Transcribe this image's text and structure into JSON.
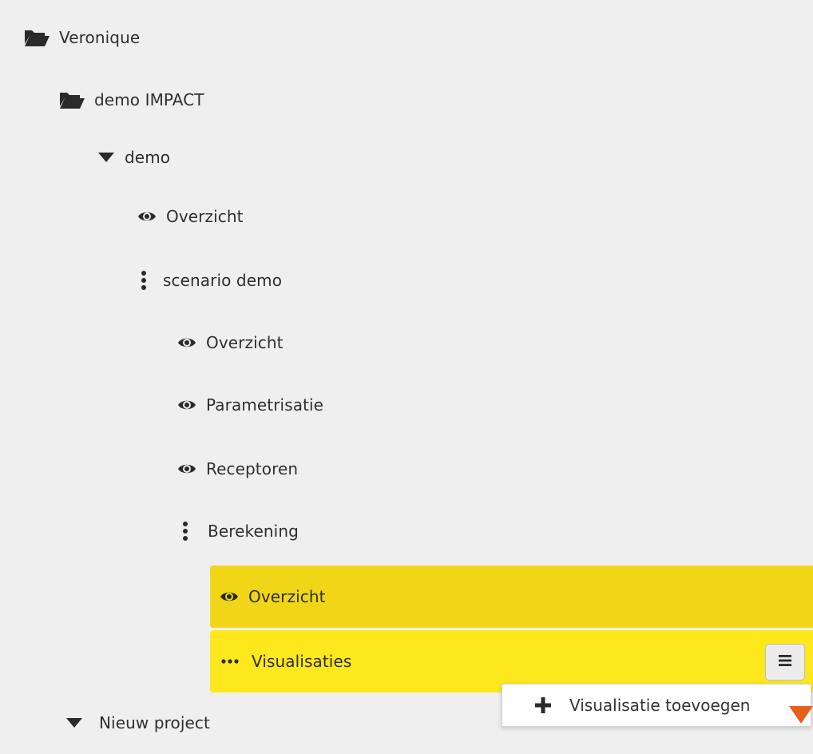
{
  "tree": {
    "root": {
      "label": "Veronique",
      "icon": "folder-open-icon"
    },
    "project": {
      "label": "demo IMPACT",
      "icon": "folder-open-icon"
    },
    "group": {
      "label": "demo",
      "icon": "caret-down-icon"
    },
    "group_overview": {
      "label": "Overzicht",
      "icon": "eye-icon"
    },
    "scenario": {
      "label": "scenario demo",
      "icon": "vertical-dots-icon"
    },
    "scenario_overview": {
      "label": "Overzicht",
      "icon": "eye-icon"
    },
    "parametrisatie": {
      "label": "Parametrisatie",
      "icon": "eye-icon"
    },
    "receptoren": {
      "label": "Receptoren",
      "icon": "eye-icon"
    },
    "berekening": {
      "label": "Berekening",
      "icon": "vertical-dots-icon"
    },
    "berekening_overview": {
      "label": "Overzicht",
      "icon": "eye-icon"
    },
    "visualisaties": {
      "label": "Visualisaties",
      "icon": "horizontal-dots-icon"
    },
    "new_project": {
      "label": "Nieuw project",
      "icon": "caret-down-icon"
    }
  },
  "context_menu": {
    "button_icon": "hamburger-icon",
    "items": [
      {
        "label": "Visualisatie toevoegen",
        "icon": "plus-icon"
      }
    ]
  },
  "colors": {
    "background": "#efefef",
    "highlight_selected": "#f0d617",
    "highlight_active": "#fde81e",
    "accent": "#e85f1c",
    "text": "#2f2f2f"
  }
}
